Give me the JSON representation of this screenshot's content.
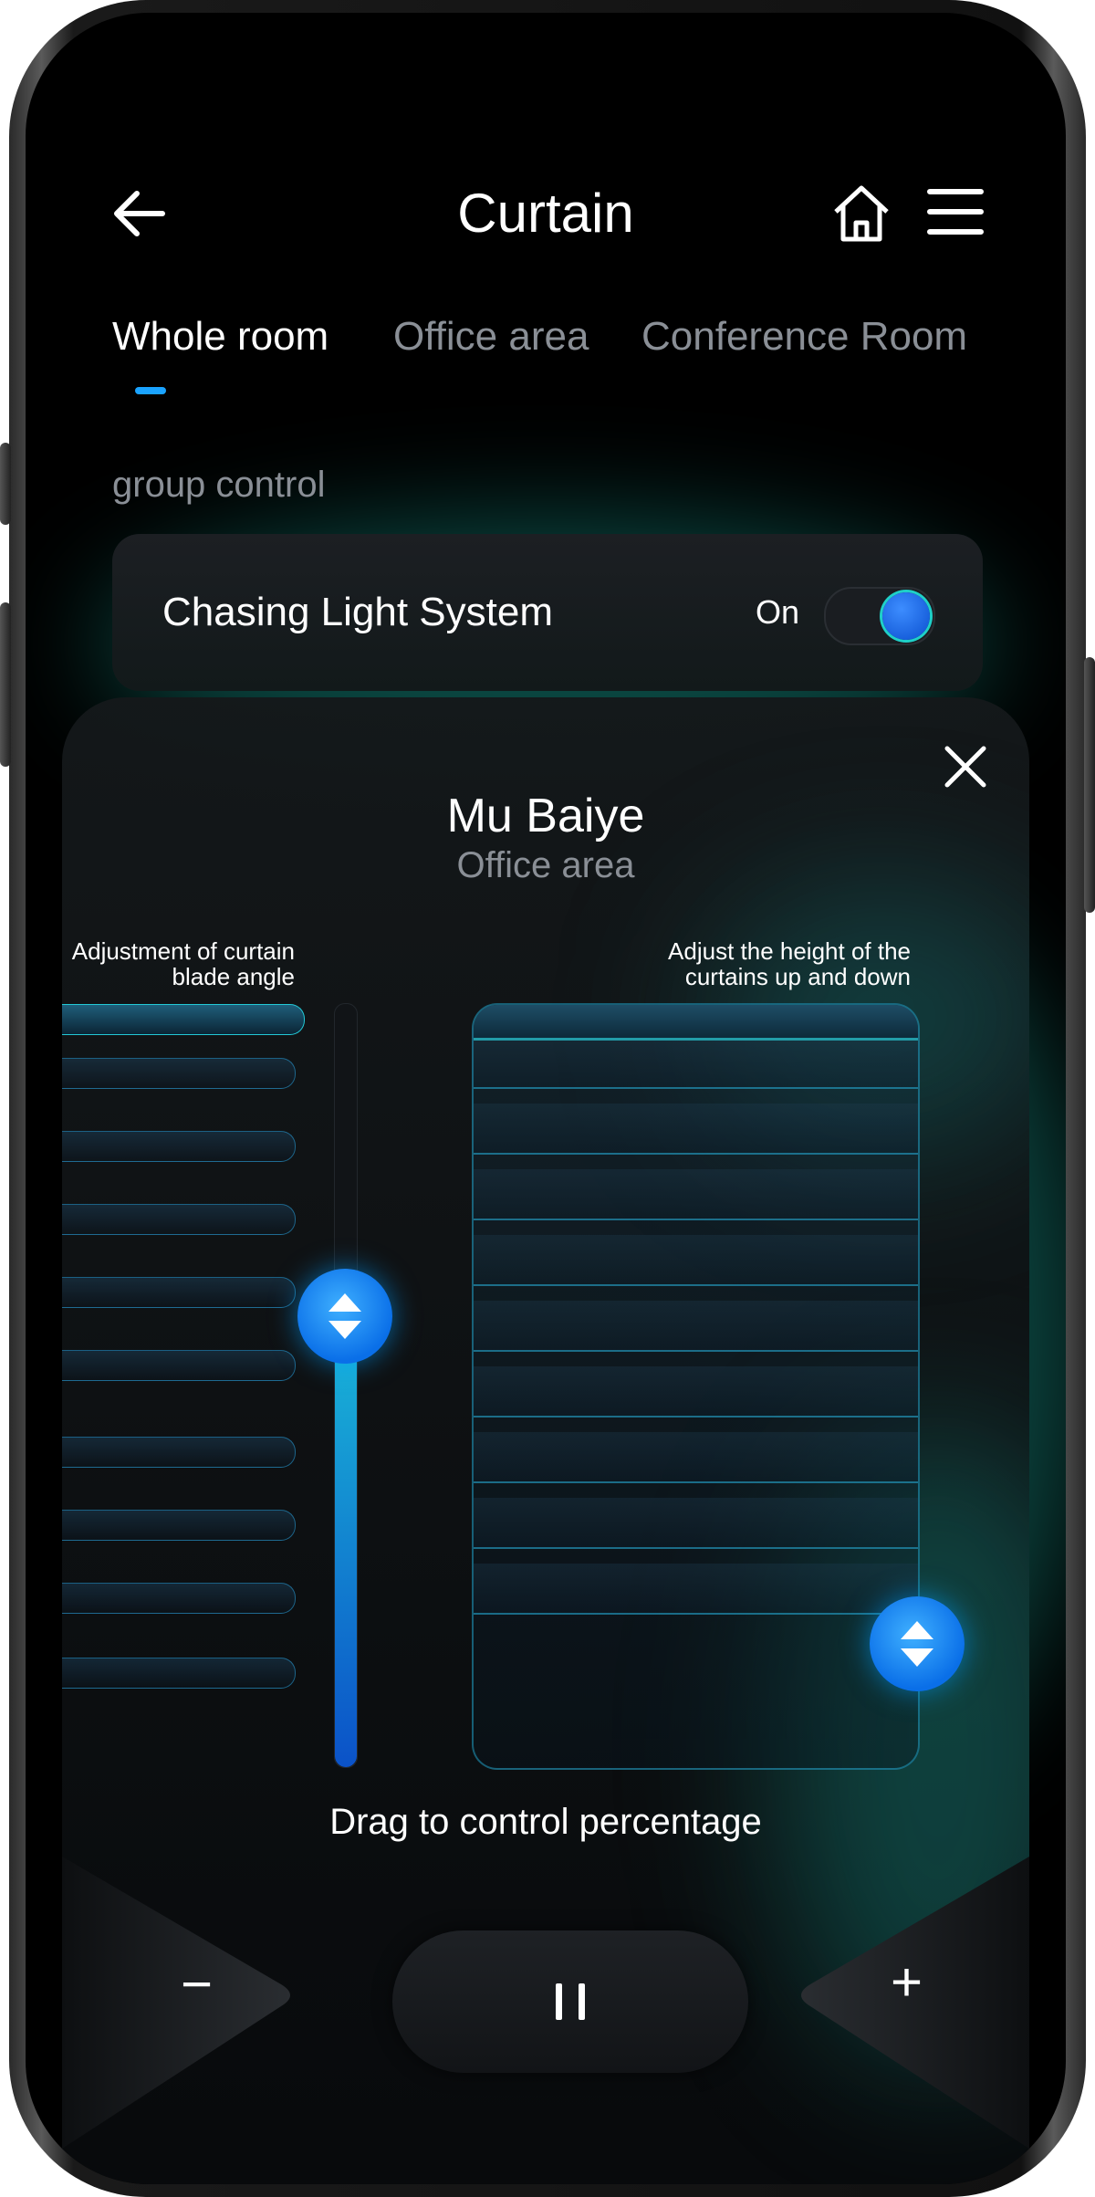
{
  "header": {
    "title": "Curtain",
    "back_icon": "arrow-left-icon",
    "home_icon": "home-icon",
    "menu_icon": "menu-icon"
  },
  "tabs": [
    {
      "label": "Whole room",
      "active": true
    },
    {
      "label": "Office area",
      "active": false
    },
    {
      "label": "Conference Room",
      "active": false
    }
  ],
  "group_control": {
    "label": "group control",
    "item": {
      "name": "Chasing Light System",
      "state_label": "On",
      "on": true
    }
  },
  "device_sheet": {
    "name": "Mu Baiye",
    "room": "Office area",
    "angle_note": "Adjustment of curtain blade angle",
    "height_note": "Adjust the height of the curtains up and down",
    "angle_level": 0.59,
    "height_level": 0.84,
    "hint": "Drag to control percentage"
  },
  "controls": {
    "minus": "−",
    "plus": "+",
    "pause_icon": "pause-icon"
  },
  "colors": {
    "accent_blue": "#1aa3ff",
    "accent_teal": "#1fd0c8",
    "background": "#000000"
  }
}
